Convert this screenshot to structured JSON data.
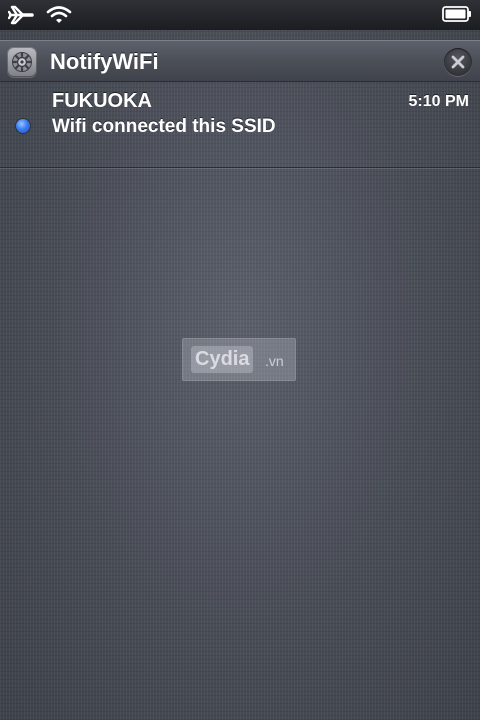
{
  "status_bar": {
    "icons": [
      "airplane-icon",
      "wifi-icon",
      "battery-icon"
    ]
  },
  "notification_center": {
    "app": {
      "name": "NotifyWiFi",
      "icon": "settings-gear-icon"
    },
    "clear_icon": "close-icon",
    "items": [
      {
        "title": "FUKUOKA",
        "time": "5:10 PM",
        "message": "Wifi connected this SSID",
        "unread_dot_color": "#3b7cf2"
      }
    ]
  },
  "watermark": {
    "text": "Cydia",
    "suffix": ".vn"
  }
}
